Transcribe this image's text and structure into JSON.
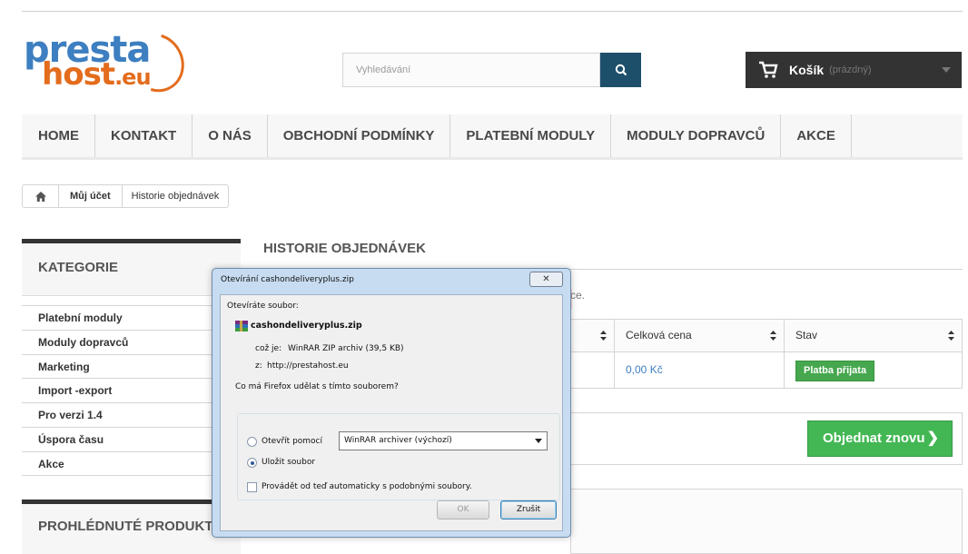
{
  "header": {
    "logo_top": "presta",
    "logo_bottom": "host",
    "logo_tld": ".eu",
    "search_placeholder": "Vyhledávání",
    "cart_label": "Košík",
    "cart_status": "(prázdný)"
  },
  "nav": {
    "items": [
      "Home",
      "Kontakt",
      "O nás",
      "Obchodní podmínky",
      "Platební moduly",
      "Moduly dopravců",
      "Akce"
    ]
  },
  "breadcrumb": {
    "account": "Můj účet",
    "current": "Historie objednávek"
  },
  "sidebar": {
    "categories_title": "Kategorie",
    "categories": [
      "Platební moduly",
      "Moduly dopravců",
      "Marketing",
      "Import -export",
      "Pro verzi 1.4",
      "Úspora času",
      "Akce"
    ],
    "viewed_title": "Prohlédnuté produkty"
  },
  "main": {
    "heading": "Historie objednávek",
    "info_tail": "ce.",
    "table_headers": [
      "Celková cena",
      "Stav"
    ],
    "row": {
      "total": "0,00 Kč",
      "status": "Platba přijata"
    },
    "reorder_label": "Objednat znovu"
  },
  "dialog": {
    "title": "Otevírání cashondeliveryplus.zip",
    "opening_label": "Otevíráte soubor:",
    "file_name": "cashondeliveryplus.zip",
    "type_label": "což je:",
    "type_value": "WinRAR ZIP archiv (39,5 KB)",
    "from_label": "z:",
    "from_value": "http://prestahost.eu",
    "question": "Co má Firefox udělat s tímto souborem?",
    "open_with_label": "Otevřít pomocí",
    "open_with_app": "WinRAR archiver (výchozí)",
    "save_label": "Uložit soubor",
    "auto_label": "Provádět od teď automaticky s podobnými soubory.",
    "ok_label": "OK",
    "cancel_label": "Zrušit",
    "selected_action": "save",
    "auto_checked": false
  },
  "colors": {
    "nav_bg": "#f7f7f7",
    "search_btn": "#1d4f6b",
    "cart_bg": "#333333",
    "status_green": "#46a74e",
    "reorder_green": "#43b754",
    "logo_blue": "#3d7fc0",
    "logo_orange": "#e36c1d"
  }
}
